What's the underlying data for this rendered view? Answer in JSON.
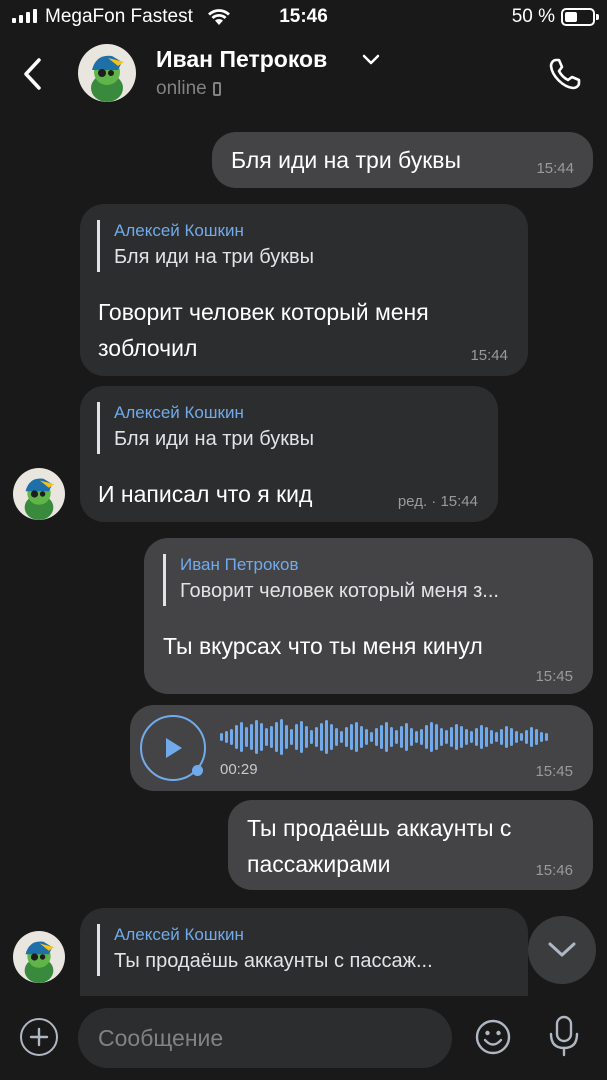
{
  "status_bar": {
    "carrier": "MegaFon Fastest",
    "time": "15:46",
    "battery": "50 %"
  },
  "header": {
    "name": "Иван Петроков",
    "status": "online"
  },
  "messages": [
    {
      "text": "Бля иди на три буквы",
      "time": "15:44"
    },
    {
      "reply_author": "Алексей Кошкин",
      "reply_text": "Бля иди на три буквы",
      "text_line1": "Говорит человек который меня",
      "text_line2": "зоблочил",
      "time": "15:44"
    },
    {
      "reply_author": "Алексей Кошкин",
      "reply_text": "Бля иди на три буквы",
      "text": "И написал что я кид",
      "time": "ред. · 15:44"
    },
    {
      "reply_author": "Иван Петроков",
      "reply_text": "Говорит человек который меня з...",
      "text": "Ты вкурсах что ты меня кинул",
      "time": "15:45"
    },
    {
      "voice_duration": "00:29",
      "time": "15:45"
    },
    {
      "text_line1": "Ты продаёшь аккаунты с",
      "text_line2": "пассажирами",
      "time": "15:46"
    },
    {
      "reply_author": "Алексей Кошкин",
      "reply_text": "Ты продаёшь аккаунты с пассаж..."
    }
  ],
  "composer": {
    "placeholder": "Сообщение"
  },
  "colors": {
    "background": "#19191a",
    "outgoing_bubble": "#444446",
    "incoming_bubble": "#2c2d2e",
    "accent": "#71aaeb"
  },
  "icons": [
    "back-icon",
    "chevron-down-icon",
    "phone-call-icon",
    "play-icon",
    "scroll-down-icon",
    "plus-icon",
    "emoji-icon",
    "microphone-icon"
  ]
}
